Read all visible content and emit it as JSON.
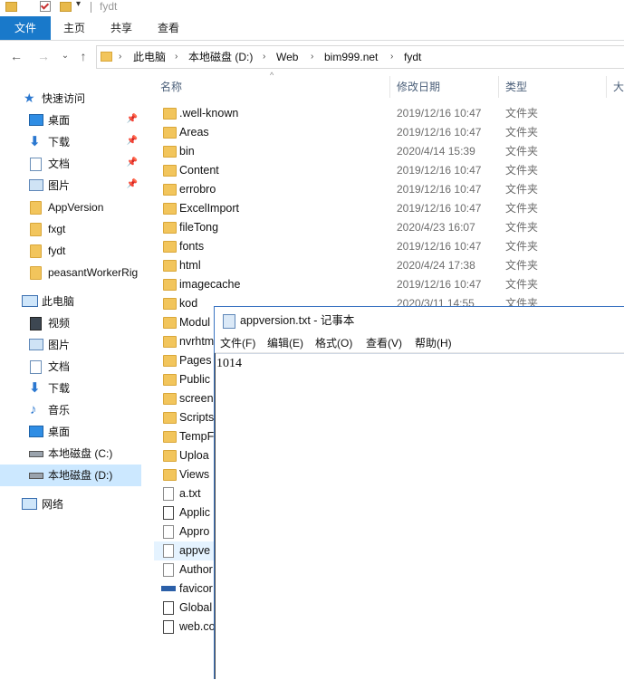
{
  "window": {
    "title": "fydt"
  },
  "ribbon": {
    "tabs": [
      "文件",
      "主页",
      "共享",
      "查看"
    ]
  },
  "address": {
    "crumbs": [
      "此电脑",
      "本地磁盘 (D:)",
      "Web",
      "bim999.net",
      "fydt"
    ]
  },
  "nav": {
    "quick_access": "快速访问",
    "pinned": [
      "桌面",
      "下载",
      "文档",
      "图片"
    ],
    "recent": [
      "AppVersion",
      "fxgt",
      "fydt",
      "peasantWorkerRig"
    ],
    "this_pc": "此电脑",
    "pc_items": [
      "视频",
      "图片",
      "文档",
      "下载",
      "音乐",
      "桌面",
      "本地磁盘 (C:)",
      "本地磁盘 (D:)"
    ],
    "network": "网络"
  },
  "columns": {
    "name": "名称",
    "date": "修改日期",
    "type": "类型",
    "size": "大"
  },
  "files": [
    {
      "name": ".well-known",
      "date": "2019/12/16 10:47",
      "type": "文件夹",
      "icon": "folder-icon"
    },
    {
      "name": "Areas",
      "date": "2019/12/16 10:47",
      "type": "文件夹",
      "icon": "folder-icon"
    },
    {
      "name": "bin",
      "date": "2020/4/14 15:39",
      "type": "文件夹",
      "icon": "folder-icon"
    },
    {
      "name": "Content",
      "date": "2019/12/16 10:47",
      "type": "文件夹",
      "icon": "folder-icon"
    },
    {
      "name": "errobro",
      "date": "2019/12/16 10:47",
      "type": "文件夹",
      "icon": "folder-icon"
    },
    {
      "name": "ExcelImport",
      "date": "2019/12/16 10:47",
      "type": "文件夹",
      "icon": "folder-icon"
    },
    {
      "name": "fileTong",
      "date": "2020/4/23 16:07",
      "type": "文件夹",
      "icon": "folder-icon"
    },
    {
      "name": "fonts",
      "date": "2019/12/16 10:47",
      "type": "文件夹",
      "icon": "folder-icon"
    },
    {
      "name": "html",
      "date": "2020/4/24 17:38",
      "type": "文件夹",
      "icon": "folder-icon"
    },
    {
      "name": "imagecache",
      "date": "2019/12/16 10:47",
      "type": "文件夹",
      "icon": "folder-icon"
    },
    {
      "name": "kod",
      "date": "2020/3/11 14:55",
      "type": "文件夹",
      "icon": "folder-icon"
    },
    {
      "name": "Modul",
      "date": "",
      "type": "",
      "icon": "folder-icon"
    },
    {
      "name": "nvrhtm",
      "date": "",
      "type": "",
      "icon": "folder-icon"
    },
    {
      "name": "Pages",
      "date": "",
      "type": "",
      "icon": "folder-icon"
    },
    {
      "name": "Public",
      "date": "",
      "type": "",
      "icon": "folder-icon"
    },
    {
      "name": "screen",
      "date": "",
      "type": "",
      "icon": "folder-icon"
    },
    {
      "name": "Scripts",
      "date": "",
      "type": "",
      "icon": "folder-icon"
    },
    {
      "name": "TempF",
      "date": "",
      "type": "",
      "icon": "folder-icon"
    },
    {
      "name": "Uploa",
      "date": "",
      "type": "",
      "icon": "folder-icon"
    },
    {
      "name": "Views",
      "date": "",
      "type": "",
      "icon": "folder-icon"
    },
    {
      "name": "a.txt",
      "date": "",
      "type": "",
      "icon": "text-file-icon"
    },
    {
      "name": "Applic",
      "date": "",
      "type": "",
      "icon": "config-file-icon"
    },
    {
      "name": "Appro",
      "date": "",
      "type": "",
      "icon": "file-icon"
    },
    {
      "name": "appve",
      "date": "",
      "type": "",
      "icon": "text-file-icon"
    },
    {
      "name": "Author",
      "date": "",
      "type": "",
      "icon": "file-icon"
    },
    {
      "name": "favicor",
      "date": "",
      "type": "",
      "icon": "favicon-icon"
    },
    {
      "name": "Global",
      "date": "",
      "type": "",
      "icon": "app-file-icon"
    },
    {
      "name": "web.co",
      "date": "",
      "type": "",
      "icon": "config-file-icon"
    }
  ],
  "notepad": {
    "title": "appversion.txt - 记事本",
    "menu": [
      "文件(F)",
      "编辑(E)",
      "格式(O)",
      "查看(V)",
      "帮助(H)"
    ],
    "content": "1014"
  },
  "colors": {
    "accent": "#1979ca",
    "folder": "#f2c55c",
    "selection": "#cce8ff"
  }
}
